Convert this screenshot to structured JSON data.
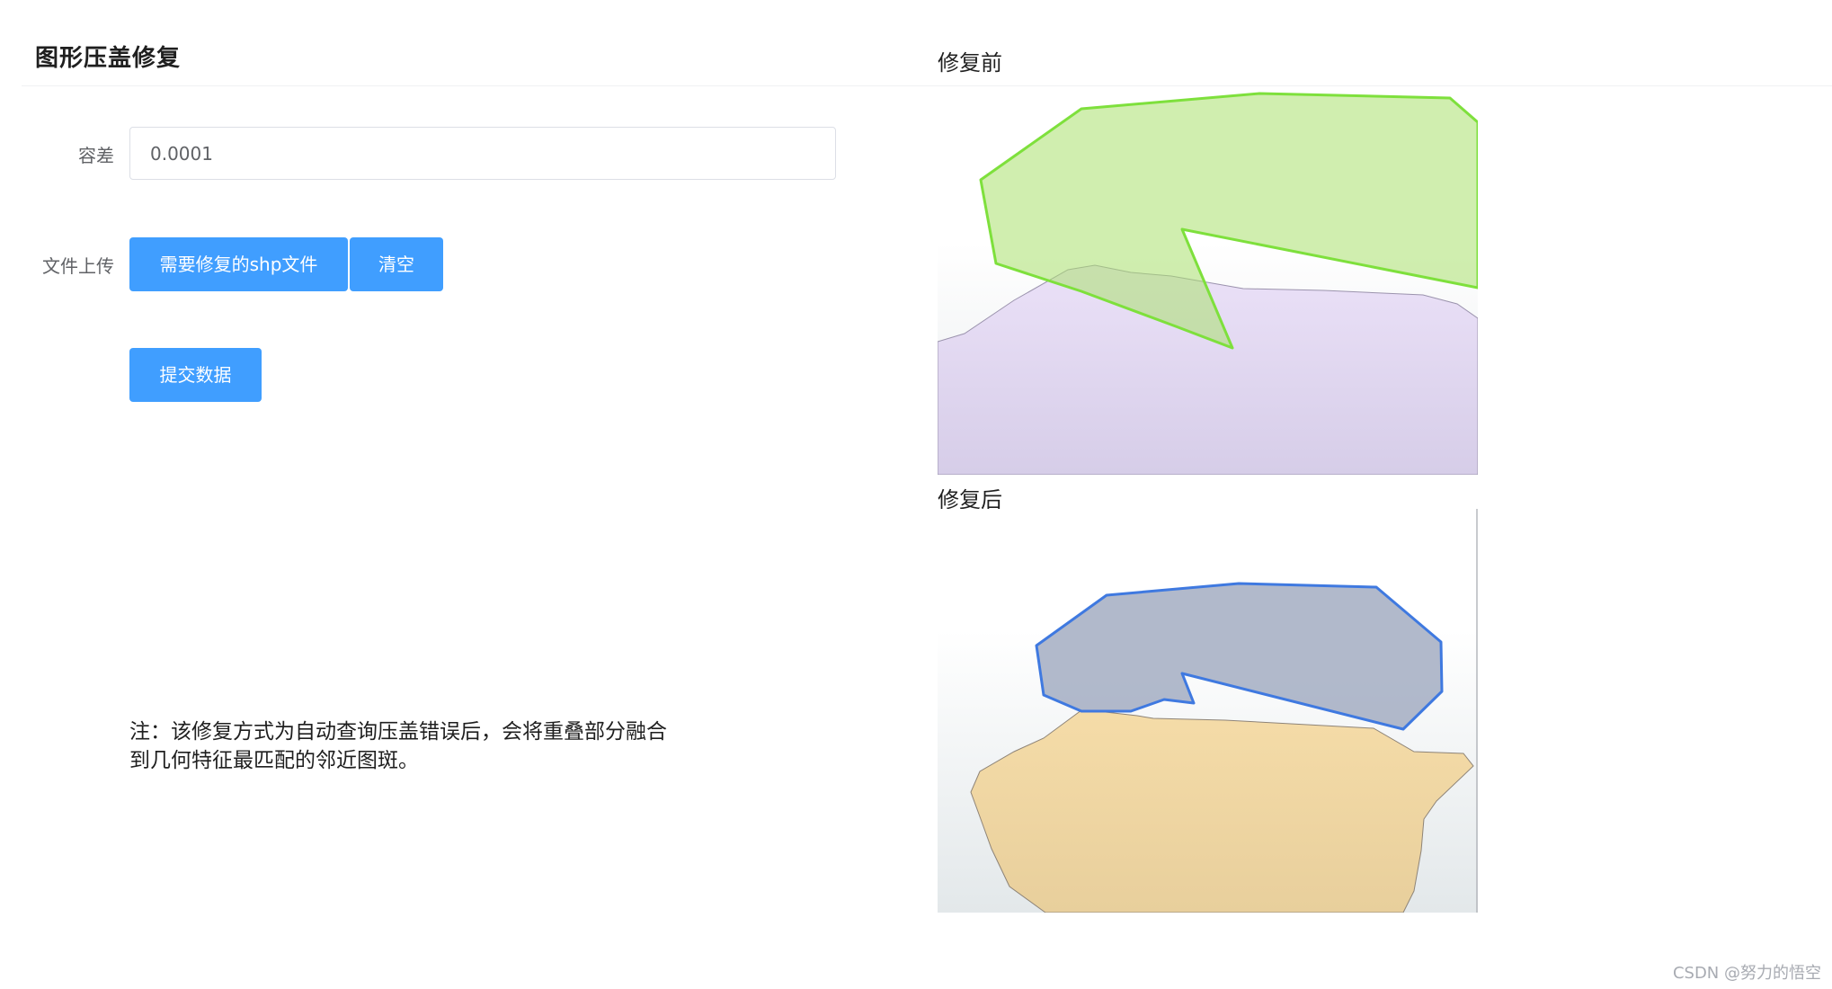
{
  "header": {
    "title": "图形压盖修复"
  },
  "form": {
    "tolerance_label": "容差",
    "tolerance_value": "0.0001",
    "upload_label": "文件上传",
    "select_file_label": "需要修复的shp文件",
    "clear_label": "清空",
    "submit_label": "提交数据"
  },
  "note": {
    "text": "注：该修复方式为自动查询压盖错误后，会将重叠部分融合到几何特征最匹配的邻近图斑。"
  },
  "maps": {
    "before_caption": "修复前",
    "after_caption": "修复后"
  },
  "colors": {
    "accent": "#409eff",
    "before_top_fill": "#cdeeb0",
    "before_top_stroke": "#7ee03c",
    "before_bottom_fill": "#e3d9f2",
    "after_top_fill": "#b2bac9",
    "after_top_stroke": "#3f79e0",
    "after_bottom_fill": "#f1d9a6"
  },
  "watermark": {
    "text": "CSDN @努力的悟空"
  }
}
